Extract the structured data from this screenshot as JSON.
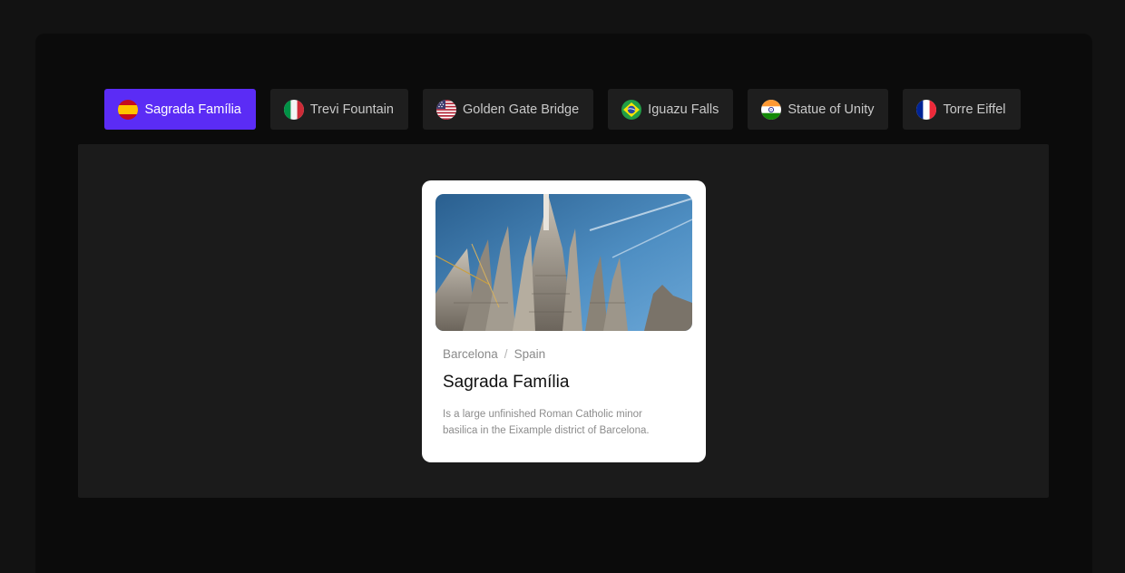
{
  "tabs": [
    {
      "label": "Sagrada Família",
      "flag": "spain-flag-icon",
      "active": true
    },
    {
      "label": "Trevi Fountain",
      "flag": "italy-flag-icon",
      "active": false
    },
    {
      "label": "Golden Gate Bridge",
      "flag": "usa-flag-icon",
      "active": false
    },
    {
      "label": "Iguazu Falls",
      "flag": "brazil-flag-icon",
      "active": false
    },
    {
      "label": "Statue of Unity",
      "flag": "india-flag-icon",
      "active": false
    },
    {
      "label": "Torre Eiffel",
      "flag": "france-flag-icon",
      "active": false
    }
  ],
  "card": {
    "image": "sagrada-familia-photo",
    "city": "Barcelona",
    "separator": "/",
    "country": "Spain",
    "title": "Sagrada Família",
    "description": "Is a large unfinished Roman Catholic minor basilica in the Eixample district of Barcelona."
  },
  "colors": {
    "accent": "#5b2cf5",
    "background": "#121212",
    "panel": "#1b1b1b",
    "tab": "#1e1e1e"
  }
}
